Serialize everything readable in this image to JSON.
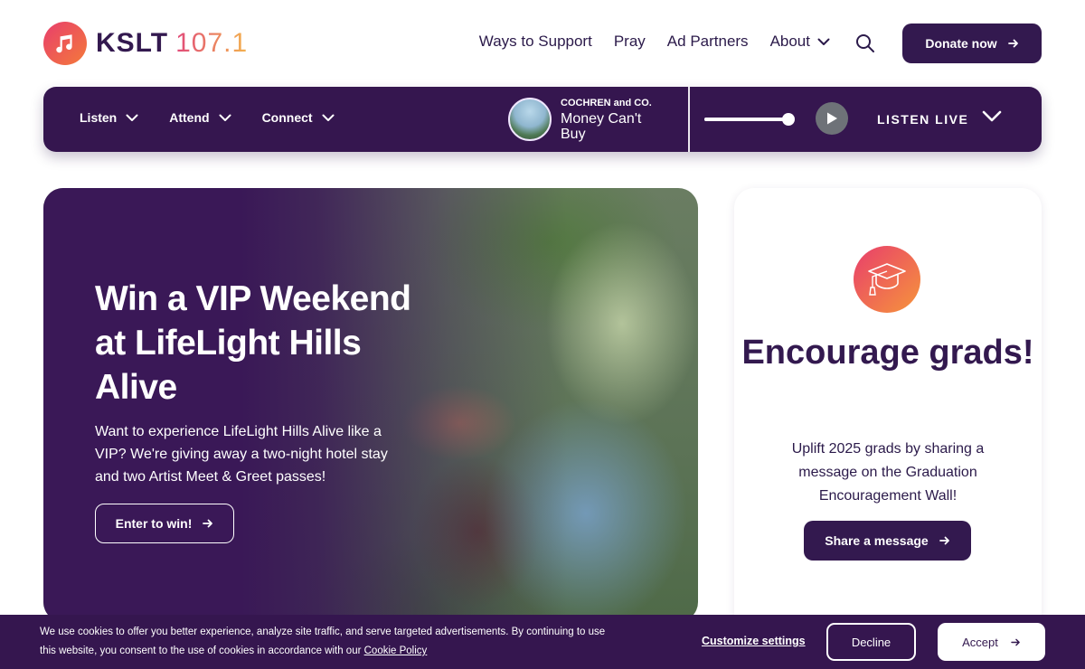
{
  "brand": {
    "call_letters": "KSLT",
    "frequency": "107.1",
    "accent_gradient": [
      "#e83e6c",
      "#f47a3a"
    ],
    "primary_color": "#33194f"
  },
  "header": {
    "nav": [
      "Ways to Support",
      "Pray",
      "Ad Partners",
      "About"
    ],
    "donate_label": "Donate now"
  },
  "player_bar": {
    "menu": [
      "Listen",
      "Attend",
      "Connect"
    ],
    "now_playing": {
      "artist": "COCHREN and CO.",
      "song": "Money Can't Buy"
    },
    "volume_level": 0.95,
    "listen_live_label": "LISTEN LIVE"
  },
  "hero": {
    "title": "Win a VIP Weekend at LifeLight Hills Alive",
    "body": "Want to experience LifeLight Hills Alive like a VIP? We're giving away a two-night hotel stay and two Artist Meet & Greet passes!",
    "cta_label": "Enter to win!"
  },
  "side_card": {
    "icon": "graduation-cap-icon",
    "title": "Encourage grads!",
    "body": "Uplift 2025 grads by sharing a message on the Graduation Encouragement Wall!",
    "cta_label": "Share a message"
  },
  "cookie_bar": {
    "text": "We use cookies to offer you better experience, analyze site traffic, and serve targeted advertisements. By continuing to use this website, you consent to the use of cookies in accordance with our",
    "policy_link": "Cookie Policy",
    "customize_label": "Customize settings",
    "decline_label": "Decline",
    "accept_label": "Accept"
  }
}
